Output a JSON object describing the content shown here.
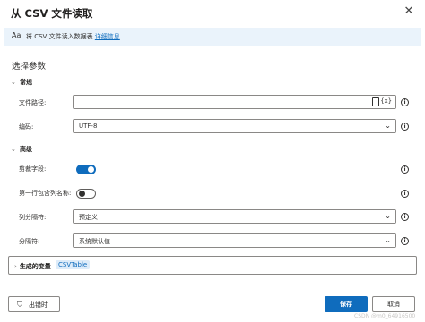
{
  "dialog": {
    "title": "从 CSV 文件读取",
    "close_icon": "close-icon"
  },
  "info": {
    "icon": "Aa",
    "text": "将 CSV 文件读入数据表",
    "link": "详细信息"
  },
  "section_title": "选择参数",
  "general": {
    "heading": "常规",
    "file_path_label": "文件路径:",
    "file_path_value": "",
    "variable_icon": "{x}",
    "encoding_label": "编码:",
    "encoding_value": "UTF-8"
  },
  "advanced": {
    "heading": "高级",
    "trim_label": "剪裁字段:",
    "trim_on": true,
    "first_row_label": "第一行包含列名称:",
    "first_row_on": false,
    "col_sep_label": "列分隔符:",
    "col_sep_value": "预定义",
    "separator_label": "分隔符:",
    "separator_value": "系统默认值"
  },
  "variables": {
    "label": "生成的变量",
    "chip": "CSVTable"
  },
  "footer": {
    "on_error": "出错时",
    "save": "保存",
    "cancel": "取消"
  },
  "watermark": "CSDN @m0_64916500"
}
